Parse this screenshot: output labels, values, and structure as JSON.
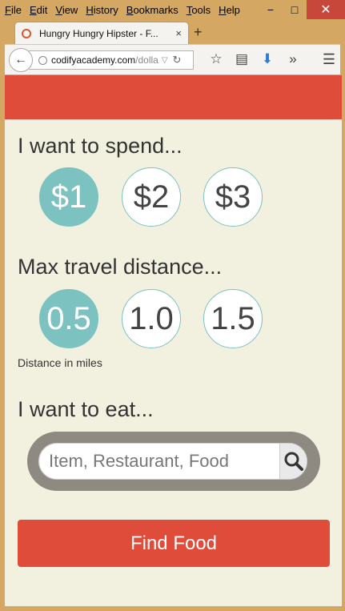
{
  "menu": [
    "File",
    "Edit",
    "View",
    "History",
    "Bookmarks",
    "Tools",
    "Help"
  ],
  "window_controls": {
    "minimize": "−",
    "maximize": "□",
    "close": "✕"
  },
  "tab": {
    "title": "Hungry Hungry Hipster - F...",
    "close": "×",
    "new": "+"
  },
  "url": {
    "host": "codifyacademy.com",
    "path": "/dolla"
  },
  "app": {
    "spend_title": "I want to spend...",
    "spend_options": [
      "$1",
      "$2",
      "$3"
    ],
    "spend_selected": "$1",
    "distance_title": "Max travel distance...",
    "distance_options": [
      "0.5",
      "1.0",
      "1.5"
    ],
    "distance_selected": "0.5",
    "distance_note": "Distance in miles",
    "eat_title": "I want to eat...",
    "search_placeholder": "Item, Restaurant, Food",
    "find_button": "Find Food"
  },
  "colors": {
    "header": "#df4c3a",
    "accent": "#7cc2c1",
    "background": "#f2f0de"
  }
}
